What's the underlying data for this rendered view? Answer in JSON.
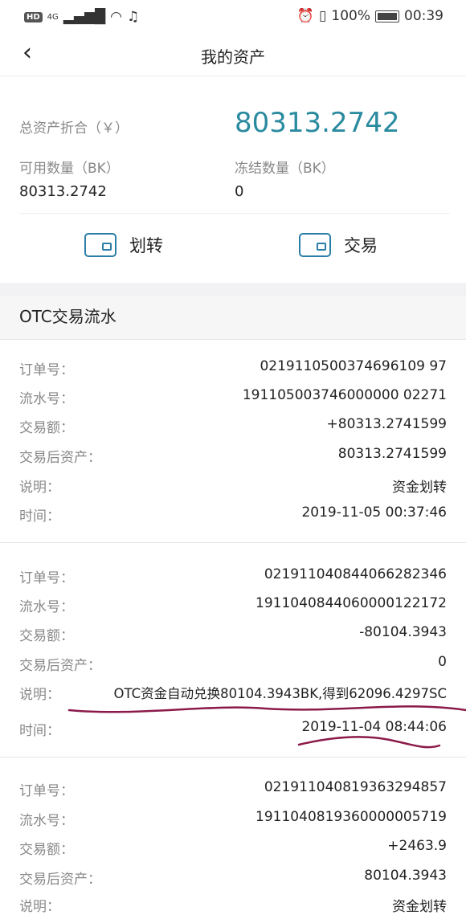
{
  "status_bar": {
    "hd": "HD",
    "signal": "4G",
    "battery_pct": "100%",
    "time": "00:39"
  },
  "nav": {
    "title": "我的资产"
  },
  "asset": {
    "total_label": "总资产折合（￥）",
    "total_value": "80313.2742",
    "available_label": "可用数量（BK）",
    "available_value": "80313.2742",
    "frozen_label": "冻结数量（BK）",
    "frozen_value": "0"
  },
  "actions": {
    "transfer": "划转",
    "trade": "交易"
  },
  "otc": {
    "title": "OTC交易流水",
    "labels": {
      "order": "订单号：",
      "serial": "流水号：",
      "amount": "交易额：",
      "after": "交易后资产：",
      "desc": "说明：",
      "time": "时间："
    },
    "records": [
      {
        "order": "0219110500374696109 97",
        "serial": "191105003746000000 02271",
        "amount": "+80313.2741599",
        "after": "80313.2741599",
        "desc": "资金划转",
        "time": "2019-11-05 00:37:46"
      },
      {
        "order": "021911040844066282346",
        "serial": "1911040844060000122172",
        "amount": "-80104.3943",
        "after": "0",
        "desc": "OTC资金自动兑换80104.3943BK,得到62096.4297SC",
        "time": "2019-11-04 08:44:06"
      },
      {
        "order": "021911040819363294857",
        "serial": "1911040819360000005719",
        "amount": "+2463.9",
        "after": "80104.3943",
        "desc": "资金划转"
      }
    ]
  },
  "colors": {
    "accent": "#2a8aa0",
    "ink": "#8b1a4a"
  }
}
